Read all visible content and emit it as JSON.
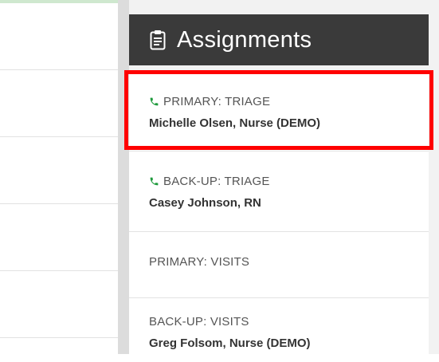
{
  "panel": {
    "title": "Assignments",
    "title_icon": "clipboard-icon"
  },
  "assignments": [
    {
      "role": "PRIMARY: TRIAGE",
      "name": "Michelle Olsen, Nurse (DEMO)",
      "icon": "phone-icon",
      "highlighted": true
    },
    {
      "role": "BACK-UP: TRIAGE",
      "name": "Casey Johnson, RN",
      "icon": "phone-icon"
    },
    {
      "role": "PRIMARY: VISITS",
      "name": ""
    },
    {
      "role": "BACK-UP: VISITS",
      "name": "Greg Folsom, Nurse (DEMO)"
    }
  ],
  "colors": {
    "header_bg": "#3a3a3a",
    "phone_icon": "#1e9a3c",
    "highlight_border": "#ff0000"
  }
}
